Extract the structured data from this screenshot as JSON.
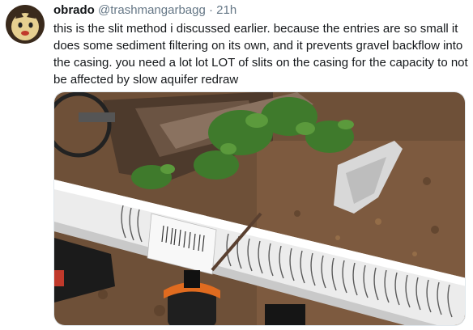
{
  "tweet": {
    "display_name": "obrado",
    "handle": "@trashmangarbagg",
    "separator": "·",
    "time": "21h",
    "text": "this is the slit method i discussed earlier. because the entries are so small it does some sediment filtering on its own, and it prevents gravel backflow into the casing. you need a lot lot LOT of slits on the casing for the capacity to not be affected by slow aquifer redraw"
  },
  "media": {
    "description_icon": "photo-pvc-pipe-with-slits"
  }
}
